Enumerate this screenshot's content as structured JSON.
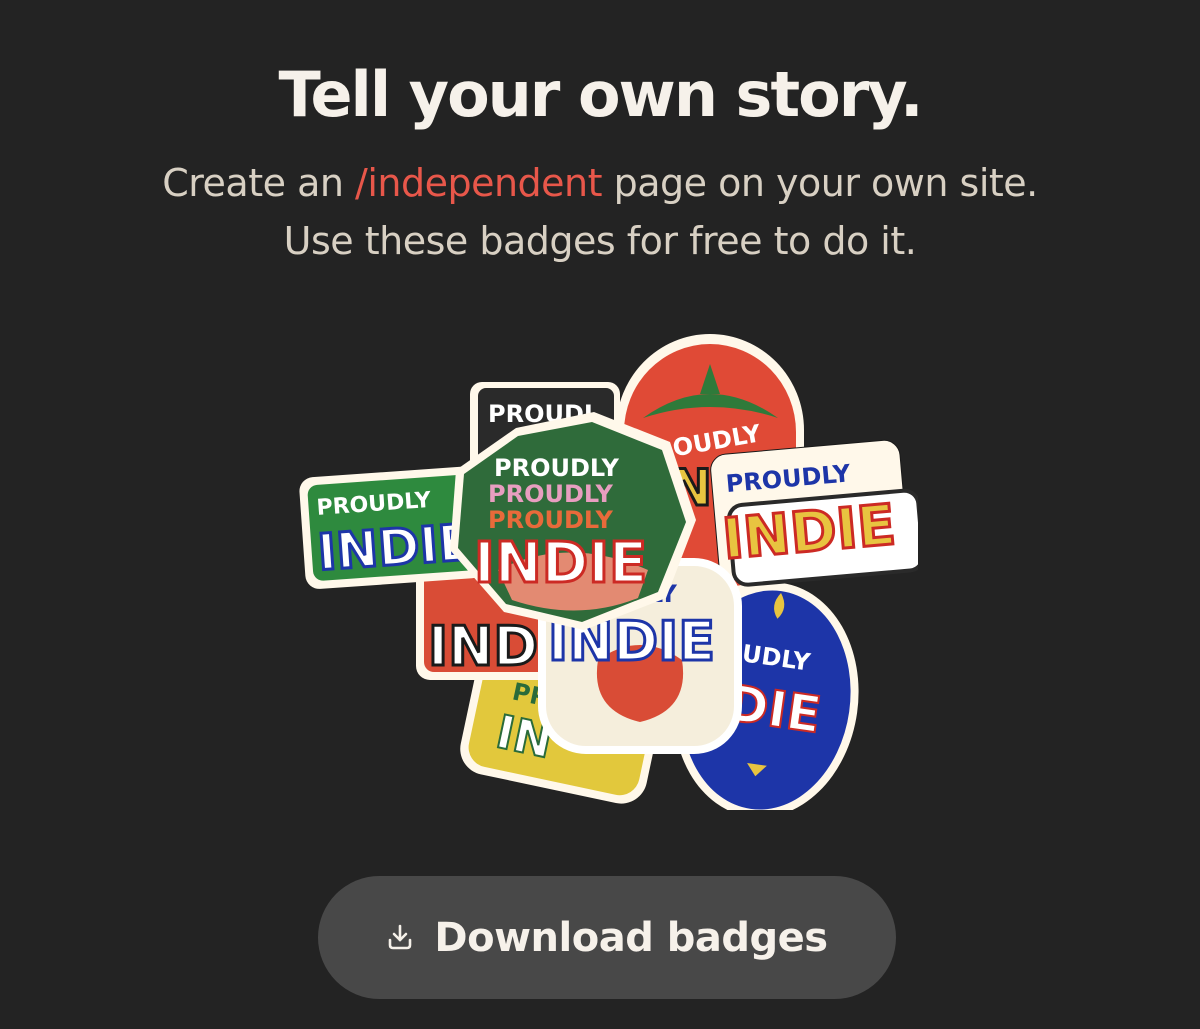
{
  "hero": {
    "title": "Tell your own story.",
    "subtitle_before": "Create an ",
    "subtitle_link": "/independent",
    "subtitle_after": " page on your own site.",
    "subtitle_line2": "Use these badges for free to do it."
  },
  "stickers": {
    "proudly": "PROUDLY",
    "indie": "INDIE",
    "partial_proudly": "PROUDL",
    "partial_udly": "UDLY",
    "partial_dly": "DLY",
    "partial_indi": "INDI",
    "partial_die": "DIE",
    "partial_ndie": "NDIE",
    "partial_in": "IN",
    "partial_pr": "PR"
  },
  "actions": {
    "download_label": "Download badges",
    "download_icon": "download-icon"
  },
  "colors": {
    "background": "#232323",
    "accent": "#e8574a",
    "button": "#484848",
    "text": "#f6f1ea"
  }
}
